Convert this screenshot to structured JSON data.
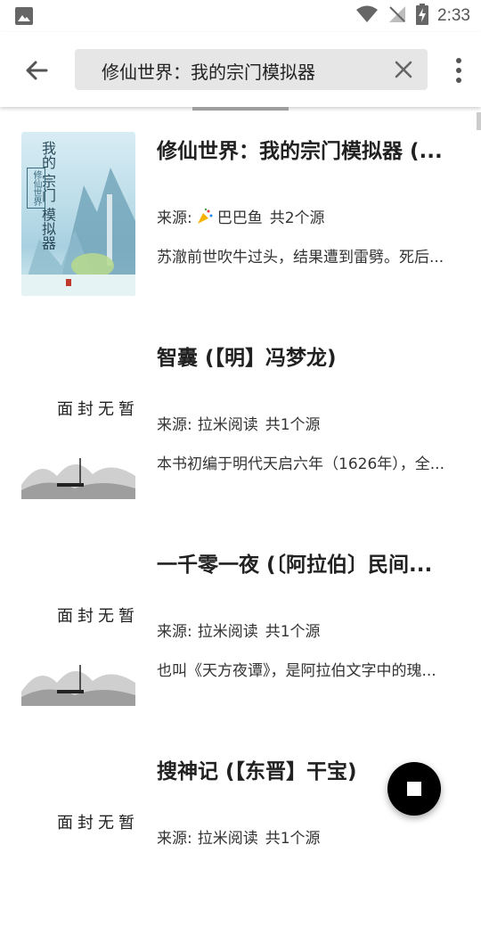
{
  "status_bar": {
    "time": "2:33"
  },
  "search": {
    "query": "修仙世界：我的宗门模拟器"
  },
  "placeholder_cover_text": [
    "暂",
    "无",
    "封",
    "面"
  ],
  "results": [
    {
      "title": "修仙世界：我的宗门模拟器 (...",
      "source_prefix": "来源:",
      "source_name": "巴巴鱼",
      "source_count": "共2个源",
      "has_party_icon": true,
      "description": "苏澈前世吹牛过头，结果遭到雷劈。死后...",
      "cover_type": "image",
      "cover_text": {
        "title_lines": [
          "我的",
          "宗门",
          "模拟器"
        ],
        "subtitle": "修仙世界"
      }
    },
    {
      "title": "智囊 (【明】冯梦龙)",
      "source_prefix": "来源:",
      "source_name": "拉米阅读",
      "source_count": "共1个源",
      "has_party_icon": false,
      "description": "本书初编于明代天启六年（1626年），全...",
      "cover_type": "placeholder"
    },
    {
      "title": "一千零一夜 (〔阿拉伯〕民间...",
      "source_prefix": "来源:",
      "source_name": "拉米阅读",
      "source_count": "共1个源",
      "has_party_icon": false,
      "description": "也叫《天方夜谭》，是阿拉伯文字中的瑰...",
      "cover_type": "placeholder"
    },
    {
      "title": "搜神记 (【东晋】干宝)",
      "source_prefix": "来源:",
      "source_name": "拉米阅读",
      "source_count": "共1个源",
      "has_party_icon": false,
      "description": "",
      "cover_type": "placeholder"
    }
  ]
}
